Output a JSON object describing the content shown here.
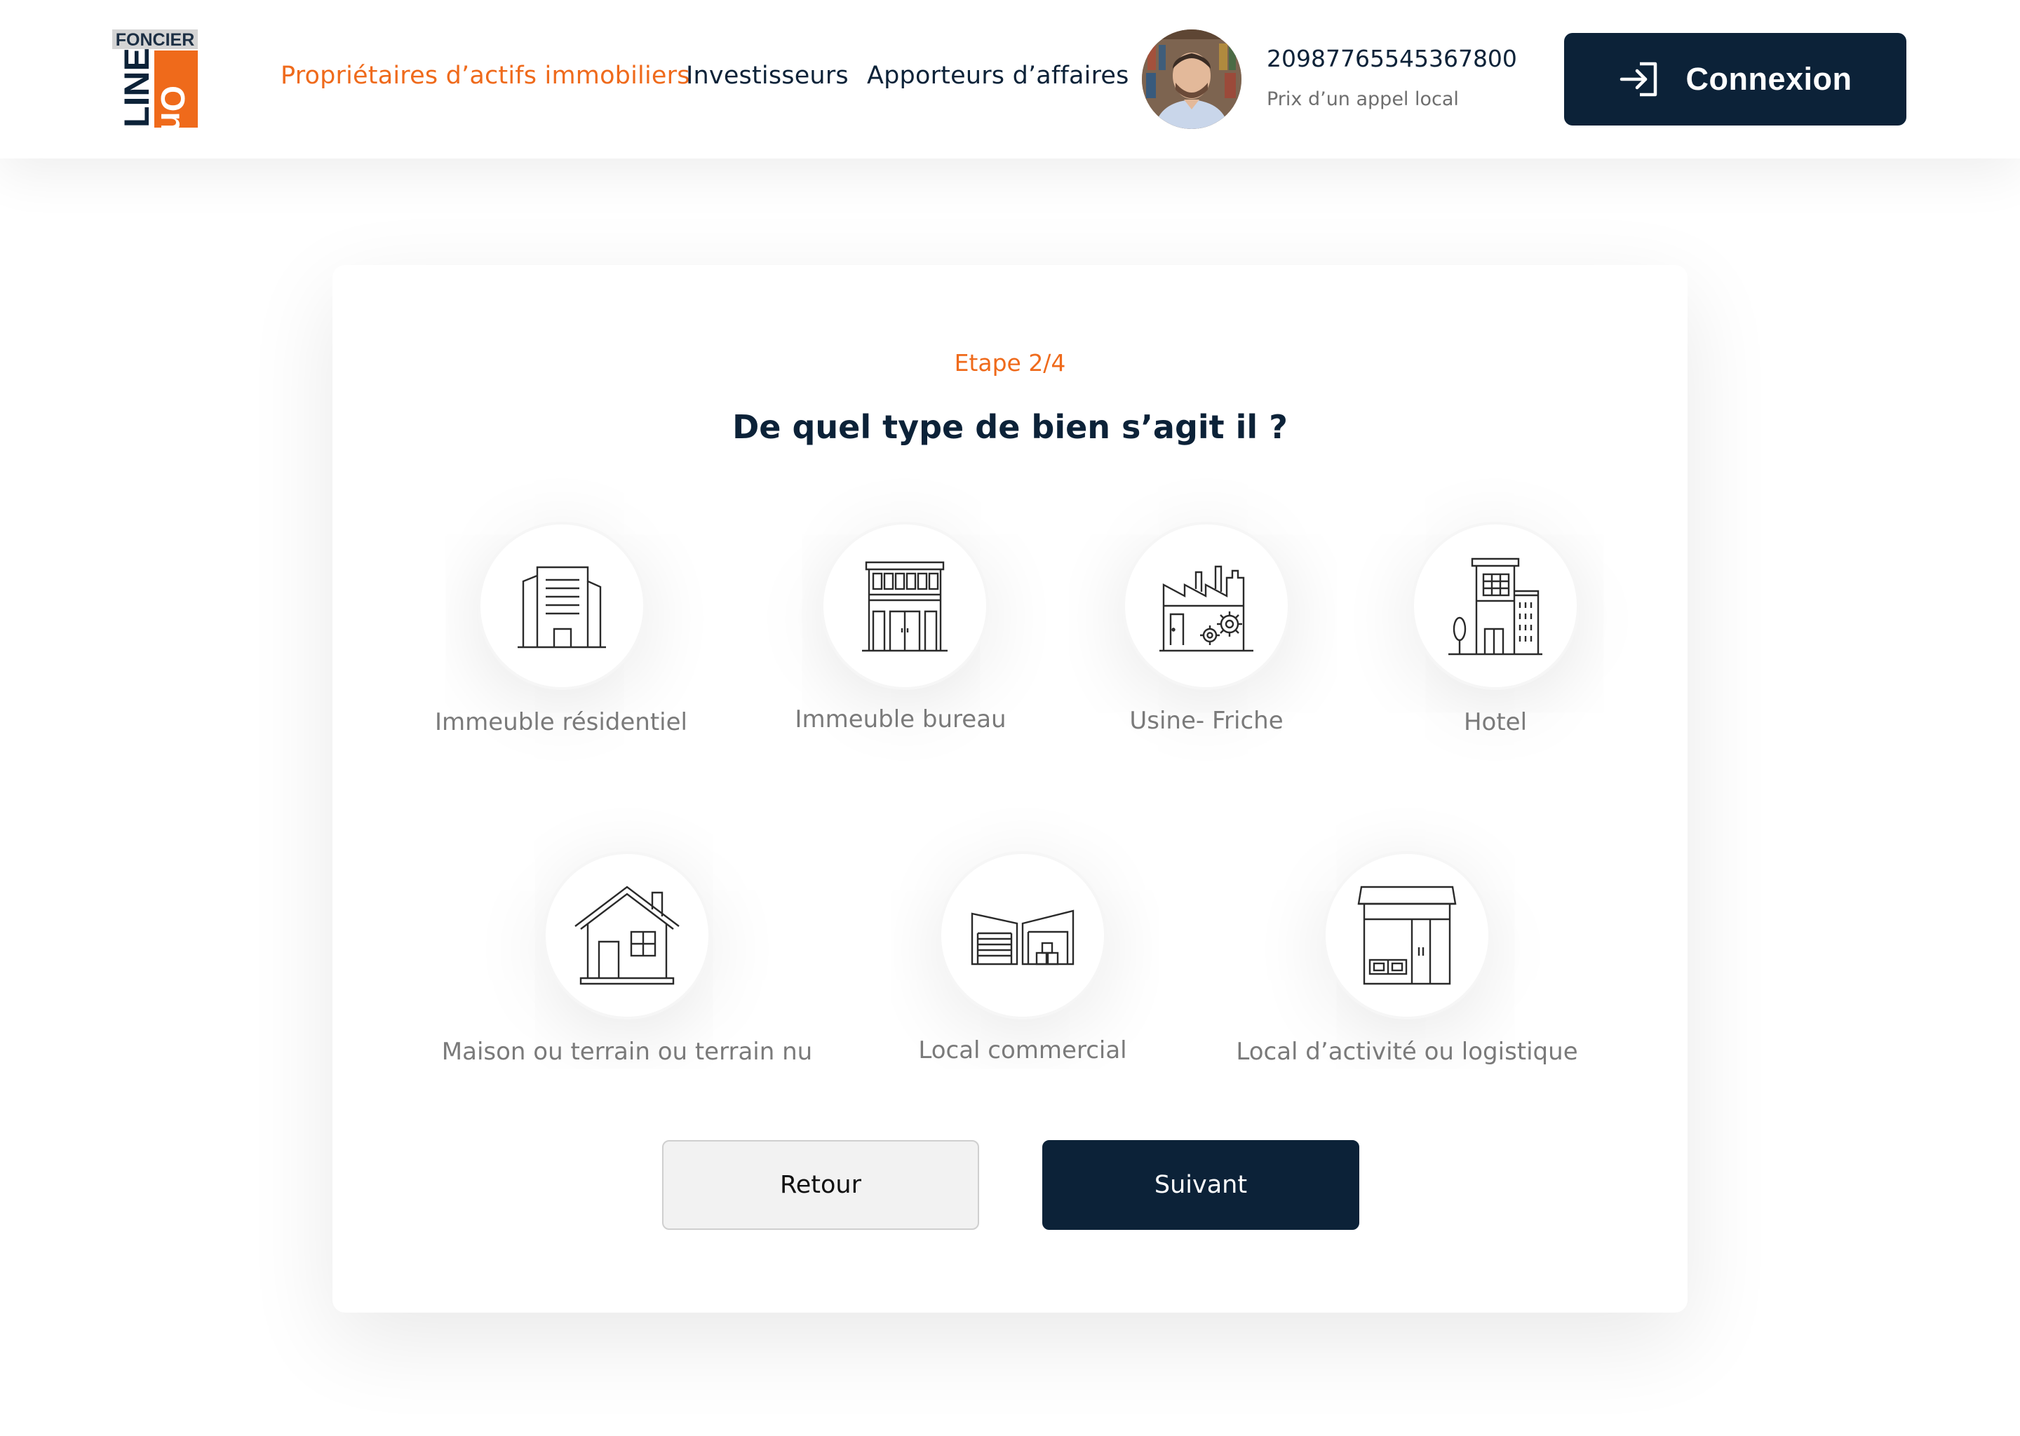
{
  "header": {
    "logo_line1": "FONCIER",
    "logo_line2": "LINE",
    "logo_line3": "On",
    "nav": [
      {
        "label": "Propriétaires d’actifs immobiliers",
        "active": true
      },
      {
        "label": "Investisseurs",
        "active": false
      },
      {
        "label": "Apporteurs d’affaires",
        "active": false
      }
    ],
    "phone_number": "20987765545367800",
    "phone_note": "Prix d’un appel local",
    "connexion_label": "Connexion"
  },
  "form": {
    "step": "Etape 2/4",
    "question": "De quel type de bien s’agit il ?",
    "options": [
      {
        "label": "Immeuble résidentiel",
        "icon": "residential-building-icon"
      },
      {
        "label": "Immeuble bureau",
        "icon": "office-building-icon"
      },
      {
        "label": "Usine- Friche",
        "icon": "factory-icon"
      },
      {
        "label": "Hotel",
        "icon": "hotel-icon"
      },
      {
        "label": "Maison ou terrain ou terrain nu",
        "icon": "house-icon"
      },
      {
        "label": "Local commercial",
        "icon": "warehouse-icon"
      },
      {
        "label": "Local d’activité ou  logistique",
        "icon": "storefront-icon"
      }
    ],
    "back_label": "Retour",
    "next_label": "Suivant"
  },
  "colors": {
    "accent": "#ef6a1b",
    "navy": "#0c2238",
    "label_gray": "#7a7a7a"
  }
}
